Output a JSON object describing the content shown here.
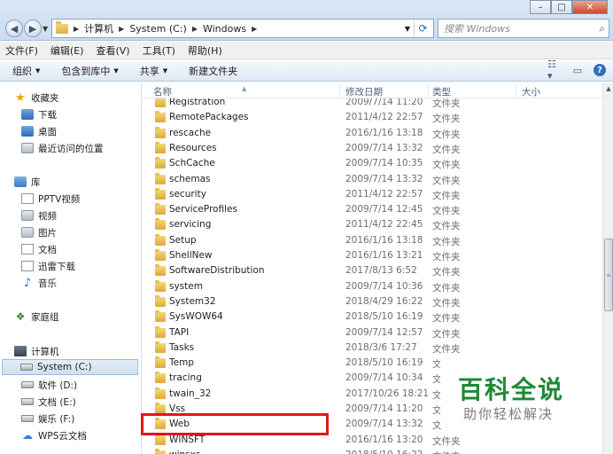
{
  "window": {
    "minimize_label": "–",
    "maximize_label": "□",
    "close_label": "✕"
  },
  "address": {
    "segments": [
      "计算机",
      "System (C:)",
      "Windows"
    ],
    "search_placeholder": "搜索 Windows"
  },
  "menu": [
    "文件(F)",
    "编辑(E)",
    "查看(V)",
    "工具(T)",
    "帮助(H)"
  ],
  "toolbar": {
    "organize": "组织",
    "include_library": "包含到库中",
    "share": "共享",
    "new_folder": "新建文件夹"
  },
  "nav": {
    "favorites": "收藏夹",
    "downloads": "下载",
    "desktop": "桌面",
    "recent": "最近访问的位置",
    "libraries": "库",
    "pptv": "PPTV视频",
    "videos": "视频",
    "pictures": "图片",
    "documents": "文档",
    "xunlei": "迅雷下载",
    "music": "音乐",
    "homegroup": "家庭组",
    "computer": "计算机",
    "drive_c": "System (C:)",
    "drive_d": "软件 (D:)",
    "drive_e": "文档 (E:)",
    "drive_f": "娱乐 (F:)",
    "wps_cloud": "WPS云文档"
  },
  "columns": {
    "name": "名称",
    "date": "修改日期",
    "type": "类型",
    "size": "大小"
  },
  "files": [
    {
      "name": "Registration",
      "date": "2009/7/14 11:20",
      "type": "文件夹"
    },
    {
      "name": "RemotePackages",
      "date": "2011/4/12 22:57",
      "type": "文件夹"
    },
    {
      "name": "rescache",
      "date": "2016/1/16 13:18",
      "type": "文件夹"
    },
    {
      "name": "Resources",
      "date": "2009/7/14 13:32",
      "type": "文件夹"
    },
    {
      "name": "SchCache",
      "date": "2009/7/14 10:35",
      "type": "文件夹"
    },
    {
      "name": "schemas",
      "date": "2009/7/14 13:32",
      "type": "文件夹"
    },
    {
      "name": "security",
      "date": "2011/4/12 22:57",
      "type": "文件夹"
    },
    {
      "name": "ServiceProfiles",
      "date": "2009/7/14 12:45",
      "type": "文件夹"
    },
    {
      "name": "servicing",
      "date": "2011/4/12 22:45",
      "type": "文件夹"
    },
    {
      "name": "Setup",
      "date": "2016/1/16 13:18",
      "type": "文件夹"
    },
    {
      "name": "ShellNew",
      "date": "2016/1/16 13:21",
      "type": "文件夹"
    },
    {
      "name": "SoftwareDistribution",
      "date": "2017/8/13 6:52",
      "type": "文件夹"
    },
    {
      "name": "system",
      "date": "2009/7/14 10:36",
      "type": "文件夹"
    },
    {
      "name": "System32",
      "date": "2018/4/29 16:22",
      "type": "文件夹"
    },
    {
      "name": "SysWOW64",
      "date": "2018/5/10 16:19",
      "type": "文件夹"
    },
    {
      "name": "TAPI",
      "date": "2009/7/14 12:57",
      "type": "文件夹"
    },
    {
      "name": "Tasks",
      "date": "2018/3/6 17:27",
      "type": "文件夹"
    },
    {
      "name": "Temp",
      "date": "2018/5/10 16:19",
      "type": "文"
    },
    {
      "name": "tracing",
      "date": "2009/7/14 10:34",
      "type": "文"
    },
    {
      "name": "twain_32",
      "date": "2017/10/26 18:21",
      "type": "文"
    },
    {
      "name": "Vss",
      "date": "2009/7/14 11:20",
      "type": "文"
    },
    {
      "name": "Web",
      "date": "2009/7/14 13:32",
      "type": "文"
    },
    {
      "name": "WINSFT",
      "date": "2016/1/16 13:20",
      "type": "文件夹"
    },
    {
      "name": "winsxs",
      "date": "2018/5/10 16:22",
      "type": "文件夹"
    }
  ],
  "watermark": {
    "main": "百科全说",
    "sub": "助你轻松解决"
  },
  "colors": {
    "highlight": "#e2161b",
    "watermark_green": "#1e8a33"
  }
}
